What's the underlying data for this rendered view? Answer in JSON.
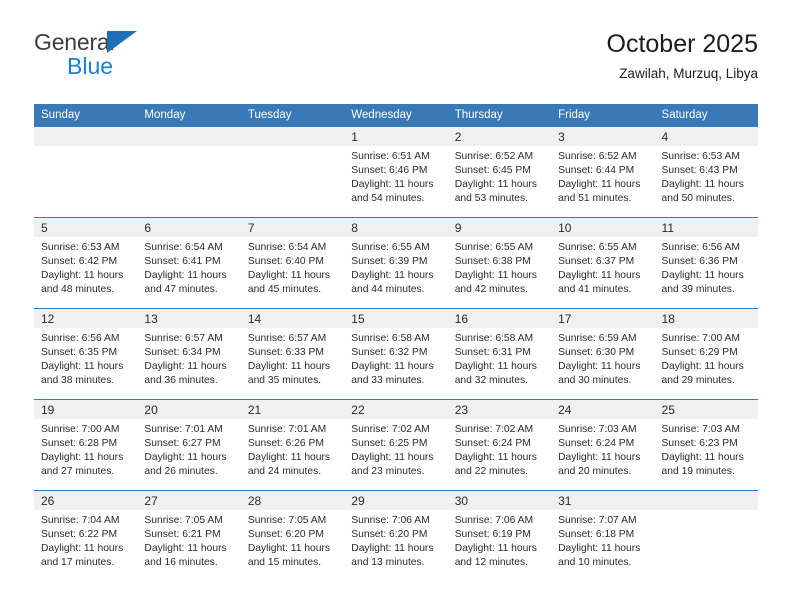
{
  "brand": {
    "name_part1": "General",
    "name_part2": "Blue",
    "triangle_icon": "triangle-icon",
    "color_dark": "#3c3c3c",
    "color_blue": "#1f7fd0",
    "accent": "#3879b8"
  },
  "header": {
    "title": "October 2025",
    "subtitle": "Zawilah, Murzuq, Libya"
  },
  "weekdays": [
    "Sunday",
    "Monday",
    "Tuesday",
    "Wednesday",
    "Thursday",
    "Friday",
    "Saturday"
  ],
  "weeks": [
    [
      {
        "day": "",
        "empty": true
      },
      {
        "day": "",
        "empty": true
      },
      {
        "day": "",
        "empty": true
      },
      {
        "day": "1",
        "sunrise": "Sunrise: 6:51 AM",
        "sunset": "Sunset: 6:46 PM",
        "daylight1": "Daylight: 11 hours",
        "daylight2": "and 54 minutes."
      },
      {
        "day": "2",
        "sunrise": "Sunrise: 6:52 AM",
        "sunset": "Sunset: 6:45 PM",
        "daylight1": "Daylight: 11 hours",
        "daylight2": "and 53 minutes."
      },
      {
        "day": "3",
        "sunrise": "Sunrise: 6:52 AM",
        "sunset": "Sunset: 6:44 PM",
        "daylight1": "Daylight: 11 hours",
        "daylight2": "and 51 minutes."
      },
      {
        "day": "4",
        "sunrise": "Sunrise: 6:53 AM",
        "sunset": "Sunset: 6:43 PM",
        "daylight1": "Daylight: 11 hours",
        "daylight2": "and 50 minutes."
      }
    ],
    [
      {
        "day": "5",
        "sunrise": "Sunrise: 6:53 AM",
        "sunset": "Sunset: 6:42 PM",
        "daylight1": "Daylight: 11 hours",
        "daylight2": "and 48 minutes."
      },
      {
        "day": "6",
        "sunrise": "Sunrise: 6:54 AM",
        "sunset": "Sunset: 6:41 PM",
        "daylight1": "Daylight: 11 hours",
        "daylight2": "and 47 minutes."
      },
      {
        "day": "7",
        "sunrise": "Sunrise: 6:54 AM",
        "sunset": "Sunset: 6:40 PM",
        "daylight1": "Daylight: 11 hours",
        "daylight2": "and 45 minutes."
      },
      {
        "day": "8",
        "sunrise": "Sunrise: 6:55 AM",
        "sunset": "Sunset: 6:39 PM",
        "daylight1": "Daylight: 11 hours",
        "daylight2": "and 44 minutes."
      },
      {
        "day": "9",
        "sunrise": "Sunrise: 6:55 AM",
        "sunset": "Sunset: 6:38 PM",
        "daylight1": "Daylight: 11 hours",
        "daylight2": "and 42 minutes."
      },
      {
        "day": "10",
        "sunrise": "Sunrise: 6:55 AM",
        "sunset": "Sunset: 6:37 PM",
        "daylight1": "Daylight: 11 hours",
        "daylight2": "and 41 minutes."
      },
      {
        "day": "11",
        "sunrise": "Sunrise: 6:56 AM",
        "sunset": "Sunset: 6:36 PM",
        "daylight1": "Daylight: 11 hours",
        "daylight2": "and 39 minutes."
      }
    ],
    [
      {
        "day": "12",
        "sunrise": "Sunrise: 6:56 AM",
        "sunset": "Sunset: 6:35 PM",
        "daylight1": "Daylight: 11 hours",
        "daylight2": "and 38 minutes."
      },
      {
        "day": "13",
        "sunrise": "Sunrise: 6:57 AM",
        "sunset": "Sunset: 6:34 PM",
        "daylight1": "Daylight: 11 hours",
        "daylight2": "and 36 minutes."
      },
      {
        "day": "14",
        "sunrise": "Sunrise: 6:57 AM",
        "sunset": "Sunset: 6:33 PM",
        "daylight1": "Daylight: 11 hours",
        "daylight2": "and 35 minutes."
      },
      {
        "day": "15",
        "sunrise": "Sunrise: 6:58 AM",
        "sunset": "Sunset: 6:32 PM",
        "daylight1": "Daylight: 11 hours",
        "daylight2": "and 33 minutes."
      },
      {
        "day": "16",
        "sunrise": "Sunrise: 6:58 AM",
        "sunset": "Sunset: 6:31 PM",
        "daylight1": "Daylight: 11 hours",
        "daylight2": "and 32 minutes."
      },
      {
        "day": "17",
        "sunrise": "Sunrise: 6:59 AM",
        "sunset": "Sunset: 6:30 PM",
        "daylight1": "Daylight: 11 hours",
        "daylight2": "and 30 minutes."
      },
      {
        "day": "18",
        "sunrise": "Sunrise: 7:00 AM",
        "sunset": "Sunset: 6:29 PM",
        "daylight1": "Daylight: 11 hours",
        "daylight2": "and 29 minutes."
      }
    ],
    [
      {
        "day": "19",
        "sunrise": "Sunrise: 7:00 AM",
        "sunset": "Sunset: 6:28 PM",
        "daylight1": "Daylight: 11 hours",
        "daylight2": "and 27 minutes."
      },
      {
        "day": "20",
        "sunrise": "Sunrise: 7:01 AM",
        "sunset": "Sunset: 6:27 PM",
        "daylight1": "Daylight: 11 hours",
        "daylight2": "and 26 minutes."
      },
      {
        "day": "21",
        "sunrise": "Sunrise: 7:01 AM",
        "sunset": "Sunset: 6:26 PM",
        "daylight1": "Daylight: 11 hours",
        "daylight2": "and 24 minutes."
      },
      {
        "day": "22",
        "sunrise": "Sunrise: 7:02 AM",
        "sunset": "Sunset: 6:25 PM",
        "daylight1": "Daylight: 11 hours",
        "daylight2": "and 23 minutes."
      },
      {
        "day": "23",
        "sunrise": "Sunrise: 7:02 AM",
        "sunset": "Sunset: 6:24 PM",
        "daylight1": "Daylight: 11 hours",
        "daylight2": "and 22 minutes."
      },
      {
        "day": "24",
        "sunrise": "Sunrise: 7:03 AM",
        "sunset": "Sunset: 6:24 PM",
        "daylight1": "Daylight: 11 hours",
        "daylight2": "and 20 minutes."
      },
      {
        "day": "25",
        "sunrise": "Sunrise: 7:03 AM",
        "sunset": "Sunset: 6:23 PM",
        "daylight1": "Daylight: 11 hours",
        "daylight2": "and 19 minutes."
      }
    ],
    [
      {
        "day": "26",
        "sunrise": "Sunrise: 7:04 AM",
        "sunset": "Sunset: 6:22 PM",
        "daylight1": "Daylight: 11 hours",
        "daylight2": "and 17 minutes."
      },
      {
        "day": "27",
        "sunrise": "Sunrise: 7:05 AM",
        "sunset": "Sunset: 6:21 PM",
        "daylight1": "Daylight: 11 hours",
        "daylight2": "and 16 minutes."
      },
      {
        "day": "28",
        "sunrise": "Sunrise: 7:05 AM",
        "sunset": "Sunset: 6:20 PM",
        "daylight1": "Daylight: 11 hours",
        "daylight2": "and 15 minutes."
      },
      {
        "day": "29",
        "sunrise": "Sunrise: 7:06 AM",
        "sunset": "Sunset: 6:20 PM",
        "daylight1": "Daylight: 11 hours",
        "daylight2": "and 13 minutes."
      },
      {
        "day": "30",
        "sunrise": "Sunrise: 7:06 AM",
        "sunset": "Sunset: 6:19 PM",
        "daylight1": "Daylight: 11 hours",
        "daylight2": "and 12 minutes."
      },
      {
        "day": "31",
        "sunrise": "Sunrise: 7:07 AM",
        "sunset": "Sunset: 6:18 PM",
        "daylight1": "Daylight: 11 hours",
        "daylight2": "and 10 minutes."
      },
      {
        "day": "",
        "empty": true
      }
    ]
  ]
}
